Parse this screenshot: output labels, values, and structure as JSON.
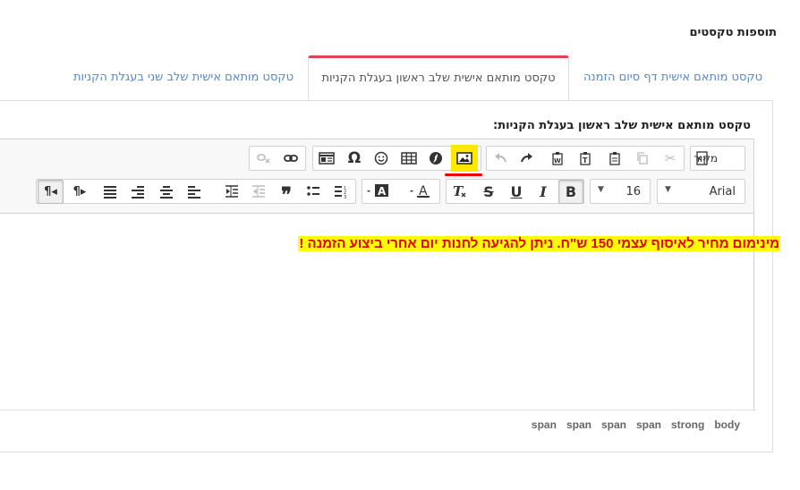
{
  "section": {
    "title": "תוספות טקסטים"
  },
  "tabs": [
    {
      "label": "טקסט מותאם אישית דף סיום הזמנה",
      "active": false
    },
    {
      "label": "טקסט מותאם אישית שלב ראשון בעגלת הקניות",
      "active": true
    },
    {
      "label": "טקסט מותאם אישית שלב שני בעגלת הקניות",
      "active": false
    }
  ],
  "field": {
    "label": "טקסט מותאם אישית שלב ראשון בעגלת הקניות:"
  },
  "toolbar": {
    "source_label": "מקור",
    "font_family": "Arial",
    "font_size": "16",
    "bold": "B",
    "italic": "I",
    "underline": "U",
    "strike": "S",
    "highlighted_button": "image",
    "highlight_color": "#ffe800",
    "underline_marker_color": "#e00000"
  },
  "content": {
    "text": "מינימום מחיר לאיסוף עצמי 150 ש\"ח. ניתן להגיעה לחנות יום אחרי ביצוע הזמנה !",
    "text_color": "#e00000",
    "background_color": "#ffff00"
  },
  "statusbar": {
    "path": [
      "body",
      "strong",
      "span",
      "span",
      "span",
      "span"
    ]
  },
  "colors": {
    "tab_accent": "#e0454b",
    "link": "#5a87c5"
  }
}
